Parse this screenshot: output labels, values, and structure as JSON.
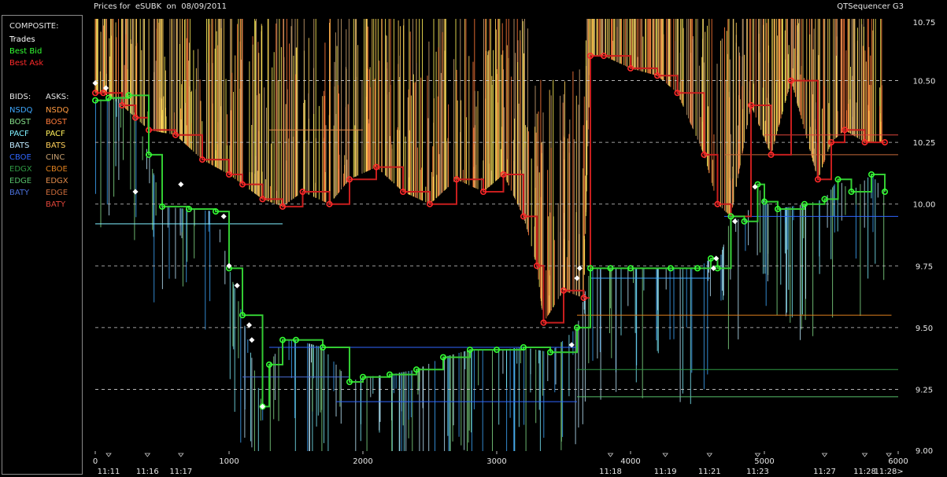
{
  "header": {
    "title": "Prices for  eSUBK  on  08/09/2011",
    "app_name": "QTSequencer G3"
  },
  "legend": {
    "composite_label": "COMPOSITE:",
    "composite": [
      {
        "label": "Trades",
        "color": "#ffffff"
      },
      {
        "label": "Best Bid",
        "color": "#33ff33"
      },
      {
        "label": "Best Ask",
        "color": "#ff2a2a"
      }
    ],
    "bids_label": "BIDS:",
    "asks_label": "ASKS:",
    "bids": [
      {
        "label": "NSDQ",
        "color": "#3fa9ff"
      },
      {
        "label": "BOST",
        "color": "#86e08a"
      },
      {
        "label": "PACF",
        "color": "#7ff0ff"
      },
      {
        "label": "BATS",
        "color": "#bfeaff"
      },
      {
        "label": "CBOE",
        "color": "#2f66ff"
      },
      {
        "label": "EDGX",
        "color": "#2f9a44"
      },
      {
        "label": "EDGE",
        "color": "#56c06a"
      },
      {
        "label": "BATY",
        "color": "#4a6fd8"
      }
    ],
    "asks": [
      {
        "label": "NSDQ",
        "color": "#ff9a40"
      },
      {
        "label": "BOST",
        "color": "#ff7a3a"
      },
      {
        "label": "PACF",
        "color": "#ffef5a"
      },
      {
        "label": "BATS",
        "color": "#ffcf5a"
      },
      {
        "label": "CINC",
        "color": "#c8a070"
      },
      {
        "label": "CBOE",
        "color": "#e0801e"
      },
      {
        "label": "EDGX",
        "color": "#e08a4a"
      },
      {
        "label": "EDGE",
        "color": "#c86a3a"
      },
      {
        "label": "BATY",
        "color": "#e0463a"
      }
    ]
  },
  "chart_data": {
    "type": "line",
    "xlim": [
      0,
      6000
    ],
    "ylim": [
      9.0,
      10.75
    ],
    "grid": true,
    "x_tick_labels": [
      "0",
      "1000",
      "2000",
      "3000",
      "4000",
      "5000",
      "6000"
    ],
    "y_tick_labels": [
      "10.75",
      "10.50",
      "10.25",
      "10.00",
      "9.75",
      "9.50",
      "9.25",
      "9.00"
    ],
    "time_labels": [
      {
        "x": 100,
        "label": "11:11"
      },
      {
        "x": 390,
        "label": "11:16"
      },
      {
        "x": 640,
        "label": "11:17"
      },
      {
        "x": 3850,
        "label": "11:18"
      },
      {
        "x": 4260,
        "label": "11:19"
      },
      {
        "x": 4590,
        "label": "11:21"
      },
      {
        "x": 4950,
        "label": "11:23"
      },
      {
        "x": 5450,
        "label": "11:27"
      },
      {
        "x": 5750,
        "label": "11:28"
      },
      {
        "x": 5930,
        "label": "11:28>"
      }
    ],
    "series": [
      {
        "name": "Best Ask",
        "x": [
          0,
          60,
          200,
          300,
          400,
          600,
          800,
          1000,
          1100,
          1250,
          1400,
          1550,
          1750,
          1900,
          2100,
          2300,
          2500,
          2700,
          2900,
          3050,
          3200,
          3300,
          3350,
          3500,
          3650,
          3700,
          3800,
          4000,
          4200,
          4350,
          4550,
          4650,
          4750,
          4900,
          5050,
          5200,
          5400,
          5500,
          5600,
          5750,
          5900
        ],
        "y": [
          10.45,
          10.45,
          10.4,
          10.35,
          10.3,
          10.28,
          10.18,
          10.12,
          10.08,
          10.02,
          9.99,
          10.05,
          10.0,
          10.1,
          10.15,
          10.05,
          10.0,
          10.1,
          10.05,
          10.12,
          9.95,
          9.75,
          9.52,
          9.65,
          9.62,
          10.6,
          10.6,
          10.55,
          10.52,
          10.45,
          10.2,
          10.0,
          9.95,
          10.4,
          10.2,
          10.5,
          10.1,
          10.25,
          10.3,
          10.25,
          10.25
        ]
      },
      {
        "name": "Best Bid",
        "x": [
          0,
          100,
          250,
          400,
          500,
          700,
          900,
          1000,
          1100,
          1250,
          1300,
          1400,
          1500,
          1700,
          1900,
          2000,
          2200,
          2400,
          2600,
          2800,
          3000,
          3200,
          3400,
          3600,
          3700,
          3850,
          4000,
          4300,
          4500,
          4600,
          4650,
          4750,
          4850,
          4950,
          5000,
          5100,
          5300,
          5450,
          5550,
          5650,
          5800,
          5900
        ],
        "y": [
          10.42,
          10.43,
          10.44,
          10.2,
          9.99,
          9.98,
          9.97,
          9.74,
          9.55,
          9.18,
          9.35,
          9.45,
          9.45,
          9.42,
          9.28,
          9.3,
          9.31,
          9.33,
          9.38,
          9.41,
          9.41,
          9.42,
          9.4,
          9.5,
          9.74,
          9.74,
          9.74,
          9.74,
          9.74,
          9.78,
          9.74,
          9.95,
          9.93,
          10.08,
          10.01,
          9.98,
          10.0,
          10.02,
          10.1,
          10.05,
          10.12,
          10.05
        ]
      },
      {
        "name": "Trades",
        "x": [
          0,
          80,
          300,
          640,
          960,
          1000,
          1060,
          1150,
          1170,
          1250,
          3560,
          3600,
          3620,
          4620,
          4640,
          4780,
          4930
        ],
        "y": [
          10.49,
          10.47,
          10.05,
          10.08,
          9.95,
          9.75,
          9.67,
          9.51,
          9.45,
          9.18,
          9.43,
          9.7,
          9.74,
          9.74,
          9.78,
          9.93,
          10.07
        ]
      }
    ]
  }
}
